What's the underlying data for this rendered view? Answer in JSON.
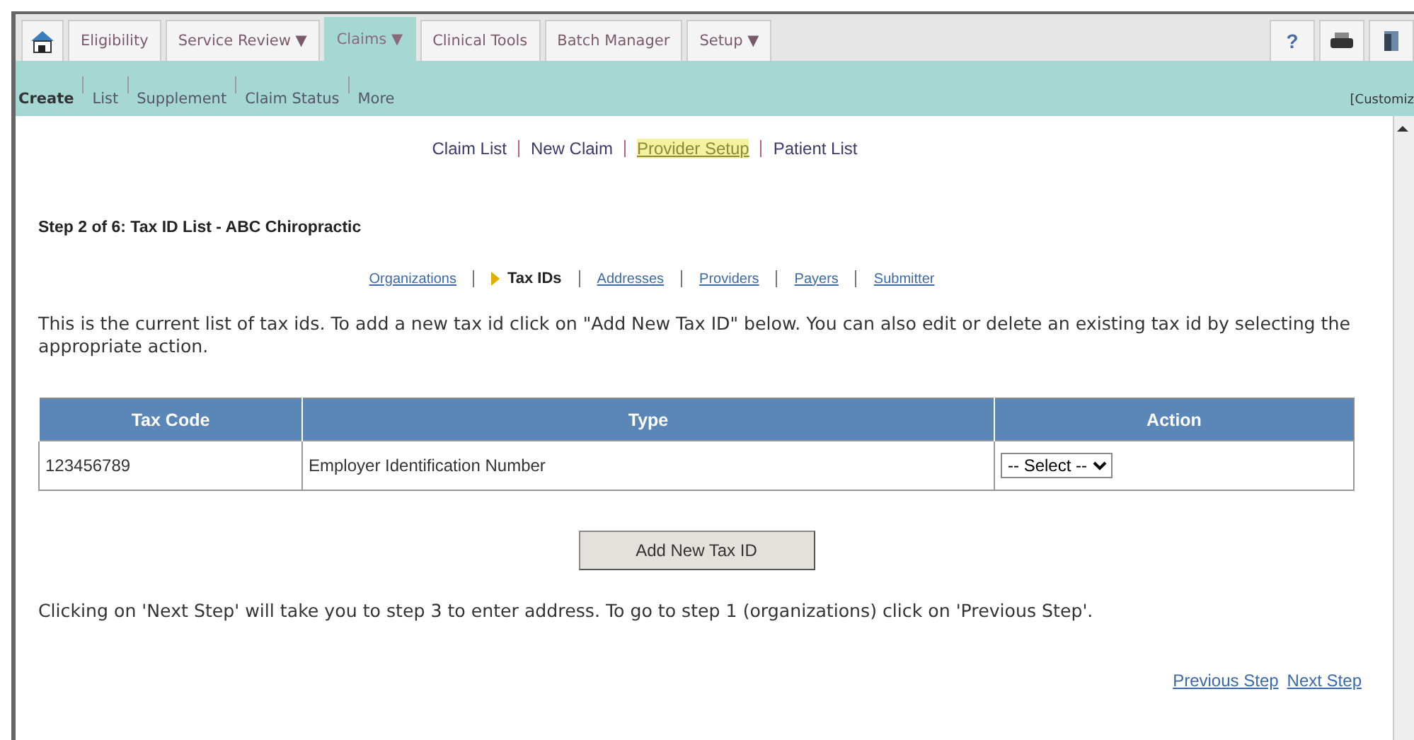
{
  "nav_tabs": [
    {
      "label": "Eligibility",
      "dropdown": false,
      "selected": false
    },
    {
      "label": "Service Review",
      "dropdown": true,
      "selected": false
    },
    {
      "label": "Claims",
      "dropdown": true,
      "selected": true
    },
    {
      "label": "Clinical Tools",
      "dropdown": false,
      "selected": false
    },
    {
      "label": "Batch Manager",
      "dropdown": false,
      "selected": false
    },
    {
      "label": "Setup",
      "dropdown": true,
      "selected": false
    }
  ],
  "dropdown_mark": "▼",
  "toolbar": [
    {
      "kind": "help",
      "label": "?"
    },
    {
      "kind": "print"
    },
    {
      "kind": "exit"
    }
  ],
  "subnav": {
    "items": [
      {
        "label": "Create",
        "selected": true
      },
      {
        "label": "List",
        "selected": false
      },
      {
        "label": "Supplement",
        "selected": false
      },
      {
        "label": "Claim Status",
        "selected": false
      },
      {
        "label": "More",
        "selected": false
      }
    ],
    "customize": "[Customiz"
  },
  "quick_links": [
    {
      "label": "Claim List",
      "highlighted": false
    },
    {
      "label": "New Claim",
      "highlighted": false
    },
    {
      "label": "Provider Setup",
      "highlighted": true
    },
    {
      "label": "Patient List",
      "highlighted": false
    }
  ],
  "step_title": "Step 2 of 6: Tax ID List - ABC Chiropractic",
  "steps": [
    {
      "label": "Organizations",
      "selected": false
    },
    {
      "label": "Tax IDs",
      "selected": true
    },
    {
      "label": "Addresses",
      "selected": false
    },
    {
      "label": "Providers",
      "selected": false
    },
    {
      "label": "Payers",
      "selected": false
    },
    {
      "label": "Submitter",
      "selected": false
    }
  ],
  "intro": "This is the current list of tax ids. To add a new tax id click on \"Add New Tax ID\" below. You can also edit or delete an existing tax id by selecting the appropriate action.",
  "table": {
    "columns": [
      "Tax Code",
      "Type",
      "Action"
    ],
    "rows": [
      {
        "tax_code": "123456789",
        "type": "Employer Identification Number",
        "action": "-- Select --"
      }
    ]
  },
  "add_button": "Add New Tax ID",
  "footer_note": "Clicking on 'Next Step' will take you to step 3 to enter address. To go to step 1 (organizations) click on 'Previous Step'.",
  "step_buttons": [
    "Previous Step",
    "Next Step"
  ]
}
